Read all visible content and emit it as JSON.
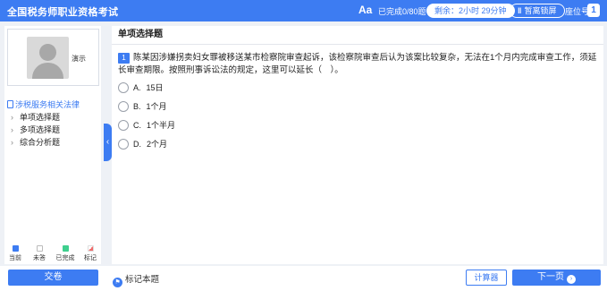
{
  "header": {
    "title": "全国税务师职业资格考试",
    "font_size_icon": "Aa",
    "progress_text": "已完成0/80题",
    "timer_text": "剩余：2小时 29分钟",
    "pause_label": "暂离锁屏",
    "seat_label": "座位号",
    "seat_number": "1"
  },
  "sidebar": {
    "user_name": "演示",
    "tree_root": "涉税服务相关法律",
    "items": [
      {
        "label": "单项选择题"
      },
      {
        "label": "多项选择题"
      },
      {
        "label": "综合分析题"
      }
    ],
    "legend": [
      {
        "label": "当前",
        "color": "#3d7cf2"
      },
      {
        "label": "未答",
        "color": "#ffffff"
      },
      {
        "label": "已完成",
        "color": "#3fcf8e"
      },
      {
        "label": "标记",
        "color": "#f06a6a"
      }
    ]
  },
  "main": {
    "section_title": "单项选择题",
    "question_number": "1",
    "question_text": "陈某因涉嫌拐卖妇女罪被移送某市检察院审查起诉，该检察院审查后认为该案比较复杂，无法在1个月内完成审查工作，须延长审查期限。按照刑事诉讼法的规定，这里可以延长（　）。",
    "options": [
      {
        "letter": "A.",
        "text": "15日"
      },
      {
        "letter": "B.",
        "text": "1个月"
      },
      {
        "letter": "C.",
        "text": "1个半月"
      },
      {
        "letter": "D.",
        "text": "2个月"
      }
    ]
  },
  "footer": {
    "submit_label": "交卷",
    "flag_label": "标记本题",
    "calculator_label": "计算器",
    "next_label": "下一页"
  },
  "colors": {
    "accent": "#3d7cf2",
    "done": "#3fcf8e",
    "flag": "#f06a6a"
  }
}
